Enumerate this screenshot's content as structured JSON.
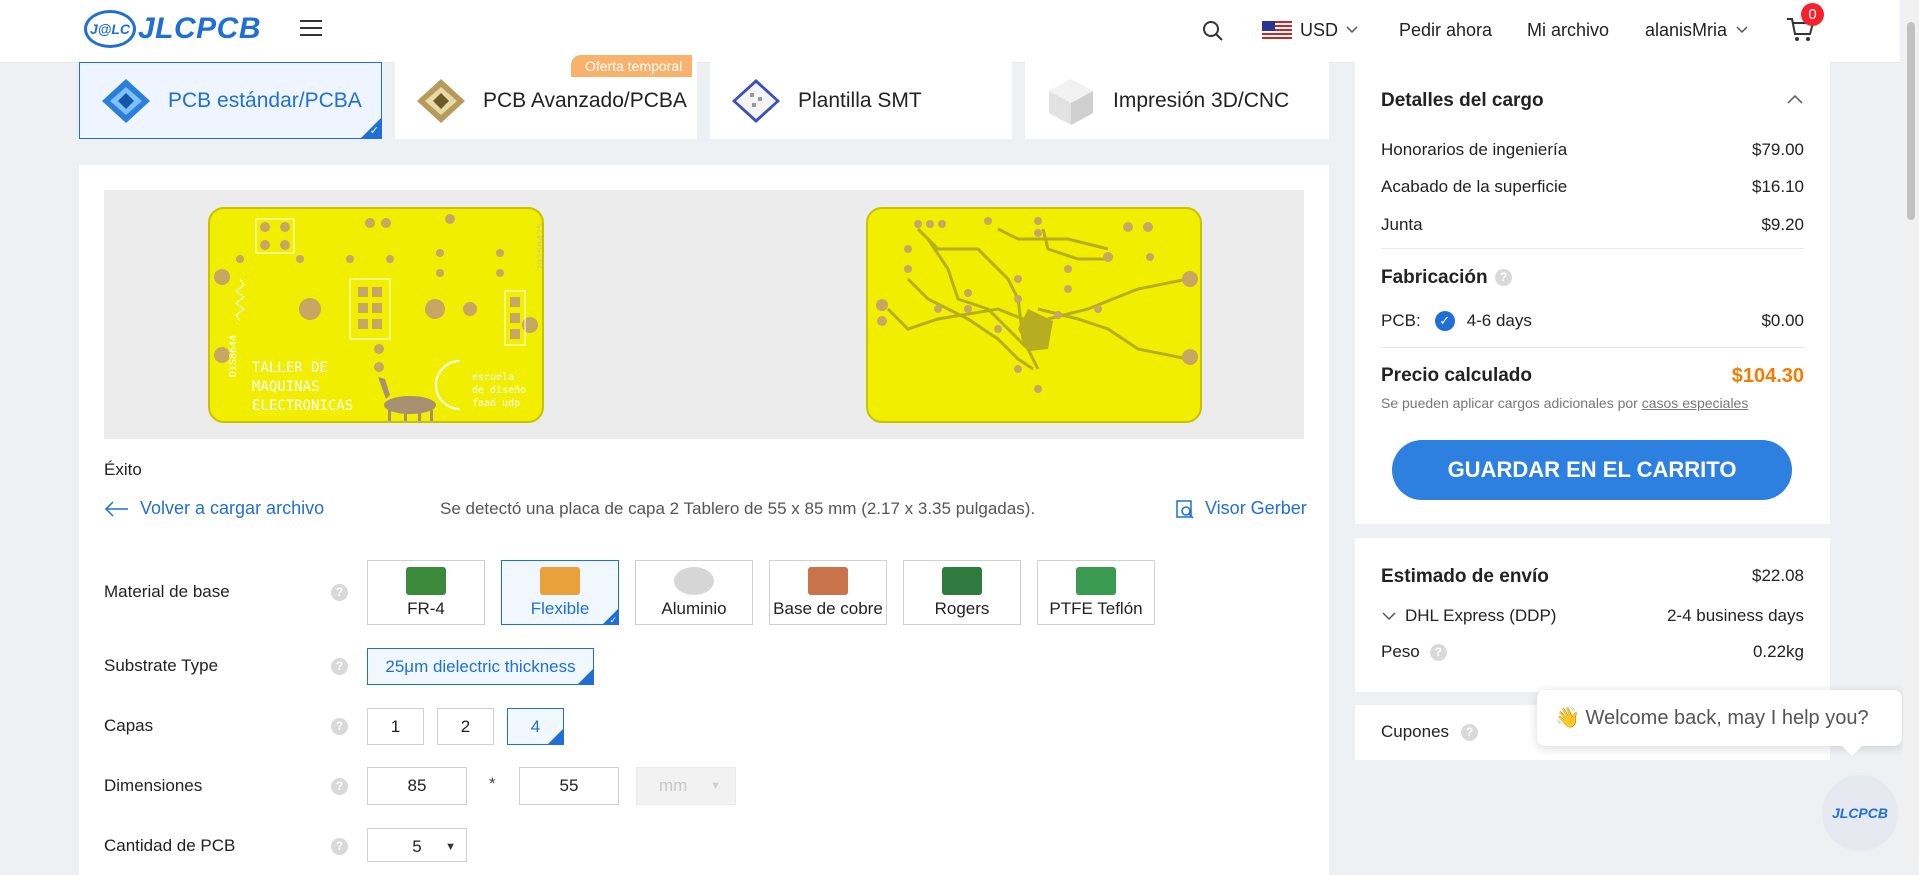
{
  "header": {
    "logo_badge": "J@LC",
    "logo_text": "JLCPCB",
    "currency": "USD",
    "order_now": "Pedir ahora",
    "my_files": "Mi archivo",
    "username": "alanisMria",
    "cart_count": "0"
  },
  "product_tabs": [
    {
      "label": "PCB estándar/PCBA",
      "active": true
    },
    {
      "label": "PCB Avanzado/PCBA",
      "badge": "Oferta temporal"
    },
    {
      "label": "Plantilla SMT"
    },
    {
      "label": "Impresión 3D/CNC"
    }
  ],
  "preview": {
    "front_silk_lines": [
      "TALLER DE",
      "MAQUINAS",
      "ELECTRONICAS"
    ],
    "front_silk_logo": [
      "escuela",
      "de diseño",
      "faad udp"
    ],
    "front_vertical_code": "DIS8644",
    "front_date": "20250425"
  },
  "upload": {
    "status": "Éxito",
    "reupload_label": "Volver a cargar archivo",
    "detected_text": "Se detectó una placa de capa 2 Tablero de 55 x 85 mm (2.17 x 3.35 pulgadas).",
    "gerber_viewer": "Visor Gerber"
  },
  "form": {
    "base_material": {
      "label": "Material de base",
      "options": [
        "FR-4",
        "Flexible",
        "Aluminio",
        "Base de cobre",
        "Rogers",
        "PTFE Teflón"
      ],
      "selected": "Flexible"
    },
    "substrate_type": {
      "label": "Substrate Type",
      "options": [
        "25μm dielectric thickness"
      ],
      "selected": "25μm dielectric thickness"
    },
    "layers": {
      "label": "Capas",
      "options": [
        "1",
        "2",
        "4"
      ],
      "selected": "4"
    },
    "dimensions": {
      "label": "Dimensiones",
      "width": "85",
      "height": "55",
      "separator": "*",
      "unit": "mm"
    },
    "quantity": {
      "label": "Cantidad de PCB",
      "value": "5"
    },
    "help_glyph": "?"
  },
  "charges": {
    "title": "Detalles del cargo",
    "items": [
      {
        "label": "Honorarios de ingeniería",
        "value": "$79.00"
      },
      {
        "label": "Acabado de la superficie",
        "value": "$16.10"
      },
      {
        "label": "Junta",
        "value": "$9.20"
      }
    ],
    "fabrication_title": "Fabricación",
    "pcb_label": "PCB:",
    "pcb_days": "4-6 days",
    "pcb_price": "$0.00",
    "calculated_label": "Precio calculado",
    "calculated_value": "$104.30",
    "note_prefix": "Se pueden aplicar cargos adicionales por",
    "note_link": "casos especiales",
    "cart_button": "GUARDAR EN EL CARRITO"
  },
  "shipping": {
    "title": "Estimado de envío",
    "price": "$22.08",
    "method": "DHL Express (DDP)",
    "duration": "2-4 business days",
    "weight_label": "Peso",
    "weight_value": "0.22kg"
  },
  "coupons": {
    "label": "Cupones"
  },
  "chat": {
    "emoji": "👋",
    "message": "Welcome back, may I help you?",
    "avatar_label": "JLCPCB"
  },
  "colors": {
    "brand_blue": "#1f6fd6",
    "price_orange": "#f57c00",
    "pcb_yellow": "#f2ee00",
    "pad_tan": "#c8a664"
  }
}
